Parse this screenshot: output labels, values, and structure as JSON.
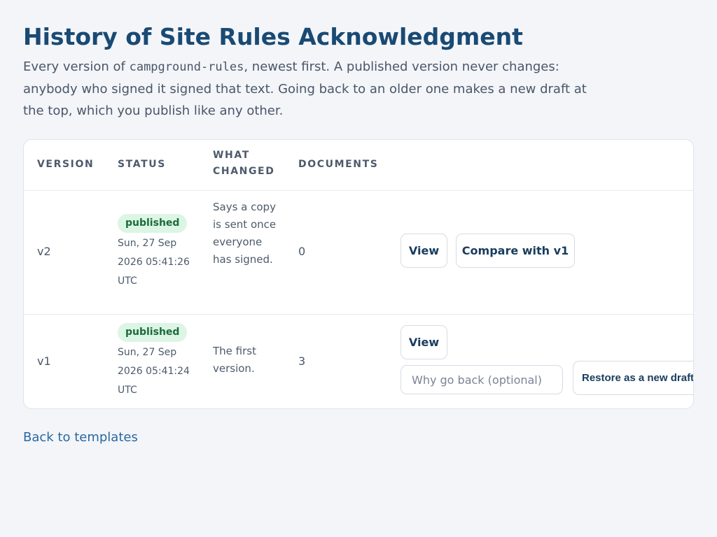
{
  "page": {
    "title": "History of Site Rules Acknowledgment",
    "intro_before": "Every version of ",
    "intro_code": "campground-rules",
    "intro_after": ", newest first. A published version never changes: anybody who signed it signed that text. Going back to an older one makes a new draft at the top, which you publish like any other."
  },
  "table": {
    "headers": {
      "version": "VERSION",
      "status": "STATUS",
      "what_changed": "WHAT CHANGED",
      "documents": "DOCUMENTS"
    },
    "rows": [
      {
        "version": "v2",
        "status": "published",
        "date": "Sun, 27 Sep 2026 05:41:26 UTC",
        "what_changed": "Says a copy is sent once everyone has signed.",
        "documents": "0",
        "view_label": "View",
        "compare_label": "Compare with v1"
      },
      {
        "version": "v1",
        "status": "published",
        "date": "Sun, 27 Sep 2026 05:41:24 UTC",
        "what_changed": "The first version.",
        "documents": "3",
        "view_label": "View",
        "reason_placeholder": "Why go back (optional)",
        "restore_label": "Restore as a new draft"
      }
    ]
  },
  "footer": {
    "back_link": "Back to templates"
  }
}
